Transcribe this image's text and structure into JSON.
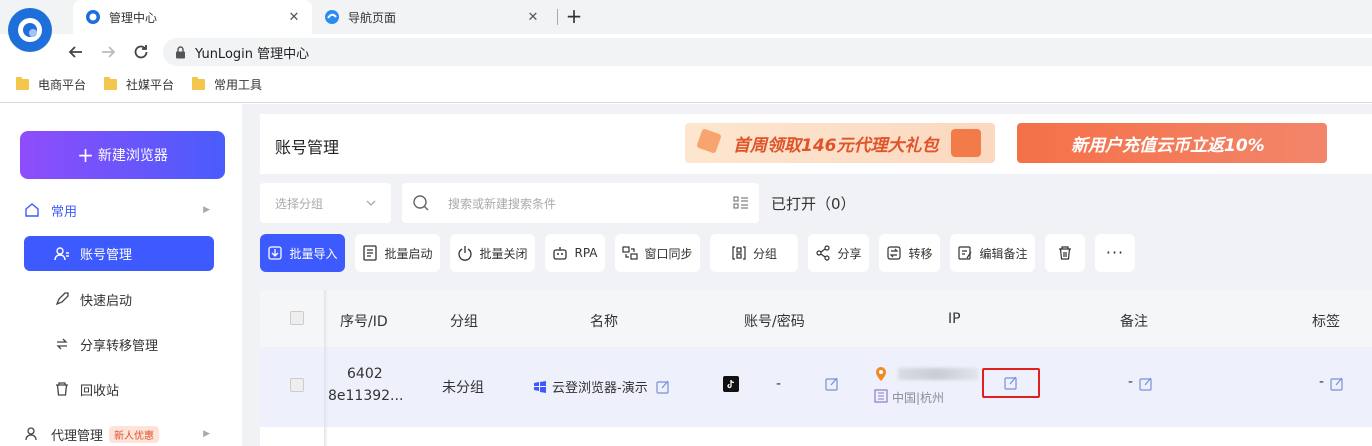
{
  "browser": {
    "tabs": [
      {
        "title": "管理中心",
        "active": true
      },
      {
        "title": "导航页面",
        "active": false
      }
    ],
    "address": "YunLogin 管理中心",
    "bookmarks": [
      "电商平台",
      "社媒平台",
      "常用工具"
    ]
  },
  "sidebar": {
    "new_button": "新建浏览器",
    "group_label": "常用",
    "items": [
      "账号管理",
      "快速启动",
      "分享转移管理",
      "回收站"
    ],
    "proxy_label": "代理管理",
    "proxy_badge": "新人优惠"
  },
  "header": {
    "title": "账号管理",
    "banner1": "首周领取146元代理大礼包",
    "banner2": "新用户充值云币立返10%"
  },
  "filters": {
    "group_placeholder": "选择分组",
    "search_placeholder": "搜索或新建搜索条件",
    "opened_label": "已打开（0）"
  },
  "toolbar": {
    "import": "批量导入",
    "start": "批量启动",
    "close": "批量关闭",
    "rpa": "RPA",
    "sync": "窗口同步",
    "group": "分组",
    "share": "分享",
    "transfer": "转移",
    "note": "编辑备注"
  },
  "table": {
    "headers": [
      "序号/ID",
      "分组",
      "名称",
      "账号/密码",
      "IP",
      "备注",
      "标签"
    ],
    "row": {
      "seq": "6402",
      "id": "8e11392...",
      "group": "未分组",
      "name": "云登浏览器-演示",
      "account": "-",
      "ip_location": "中国|杭州",
      "note": "-",
      "tag": "-"
    }
  },
  "colors": {
    "primary": "#3d5afe",
    "new_button_gradient": [
      "#8f4dfb",
      "#4a5cfb"
    ],
    "highlight_box": "#e0201f"
  }
}
